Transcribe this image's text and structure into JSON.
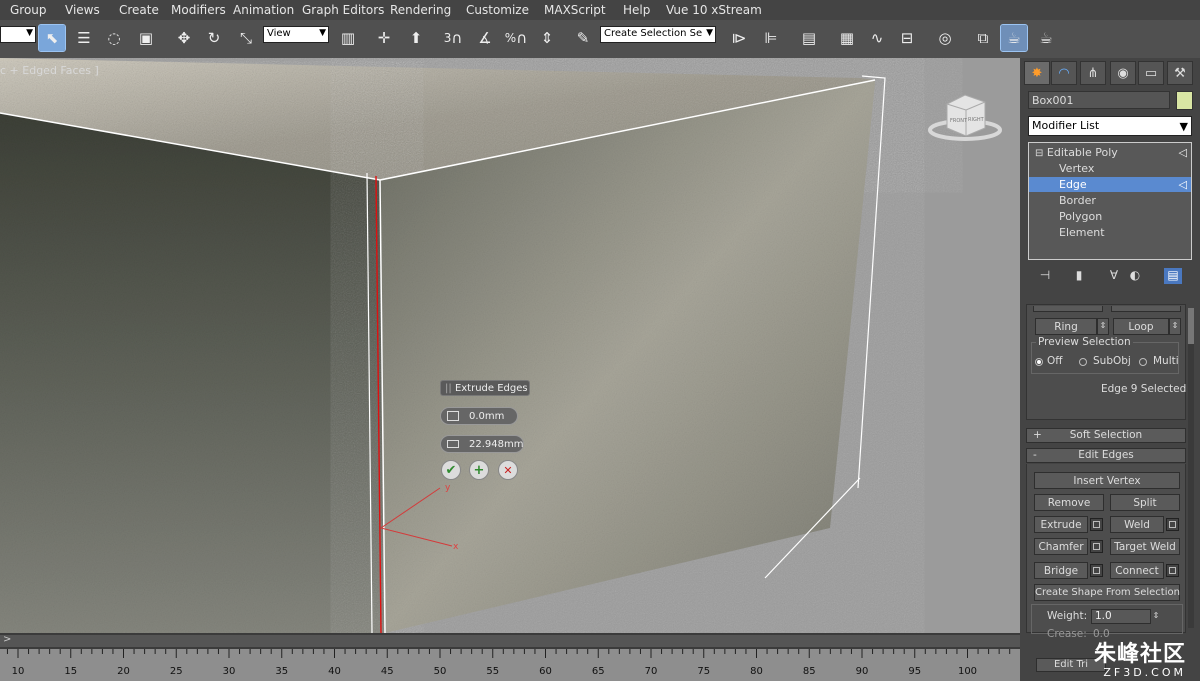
{
  "menu": [
    "Group",
    "Views",
    "Create",
    "Modifiers",
    "Animation",
    "Graph Editors",
    "Rendering",
    "Customize",
    "MAXScript",
    "Help",
    "Vue 10 xStream"
  ],
  "toolbar": {
    "view_dropdown": "View",
    "snap_labels": [
      "3",
      "%"
    ],
    "selection_set_dropdown": "Create Selection Se",
    "icons": [
      "select-object-icon",
      "select-by-name-icon",
      "circle-region-icon",
      "window-crossing-icon",
      "move-icon",
      "rotate-icon",
      "scale-icon",
      "mirror-icon",
      "align-icon",
      "layer-icon",
      "curve-editor-icon",
      "schematic-icon",
      "material-editor-icon",
      "render-setup-icon",
      "render-icon",
      "teapot-icon"
    ]
  },
  "viewport": {
    "label": "c + Edged Faces ]",
    "caddy": {
      "title": "Extrude Edges",
      "height_value": "0.0mm",
      "width_value": "22.948mm",
      "ok_symbol": "✔",
      "apply_symbol": "+",
      "cancel_symbol": "✕"
    },
    "gizmo_axes": {
      "y": "y",
      "x": "x"
    },
    "viewcube_faces": [
      "FRONT",
      "RIGHT"
    ]
  },
  "command_panel": {
    "object_name": "Box001",
    "object_color": "#d9e6a4",
    "modifier_list_label": "Modifier List",
    "stack": [
      {
        "label": "Editable Poly",
        "toggle": "⊟",
        "selected": false
      },
      {
        "label": "Vertex",
        "selected": false
      },
      {
        "label": "Edge",
        "selected": true
      },
      {
        "label": "Border",
        "selected": false
      },
      {
        "label": "Polygon",
        "selected": false
      },
      {
        "label": "Element",
        "selected": false
      }
    ],
    "selection": {
      "ring_label": "Ring",
      "loop_label": "Loop",
      "preview_title": "Preview Selection",
      "off_label": "Off",
      "subobj_label": "SubObj",
      "multi_label": "Multi",
      "status": "Edge 9 Selected"
    },
    "soft_selection": {
      "sign": "+",
      "title": "Soft Selection"
    },
    "edit_edges": {
      "sign": "-",
      "title": "Edit Edges",
      "insert_vertex": "Insert Vertex",
      "remove": "Remove",
      "split": "Split",
      "extrude": "Extrude",
      "weld": "Weld",
      "chamfer": "Chamfer",
      "target_weld": "Target Weld",
      "bridge": "Bridge",
      "connect": "Connect",
      "create_shape": "Create Shape From Selection",
      "weight_label": "Weight:",
      "weight_value": "1.0",
      "crease_label": "Crease:",
      "crease_value": "0.0",
      "edit_tri_label": "Edit Tri"
    }
  },
  "timeline": {
    "ticks": [
      "10",
      "15",
      "20",
      "25",
      "30",
      "35",
      "40",
      "45",
      "50",
      "55",
      "60",
      "65",
      "70",
      "75",
      "80",
      "85",
      "90",
      "95",
      "100"
    ],
    "left_arrow": ">"
  },
  "watermark": {
    "text": "朱峰社区",
    "url": "ZF3D.COM"
  }
}
